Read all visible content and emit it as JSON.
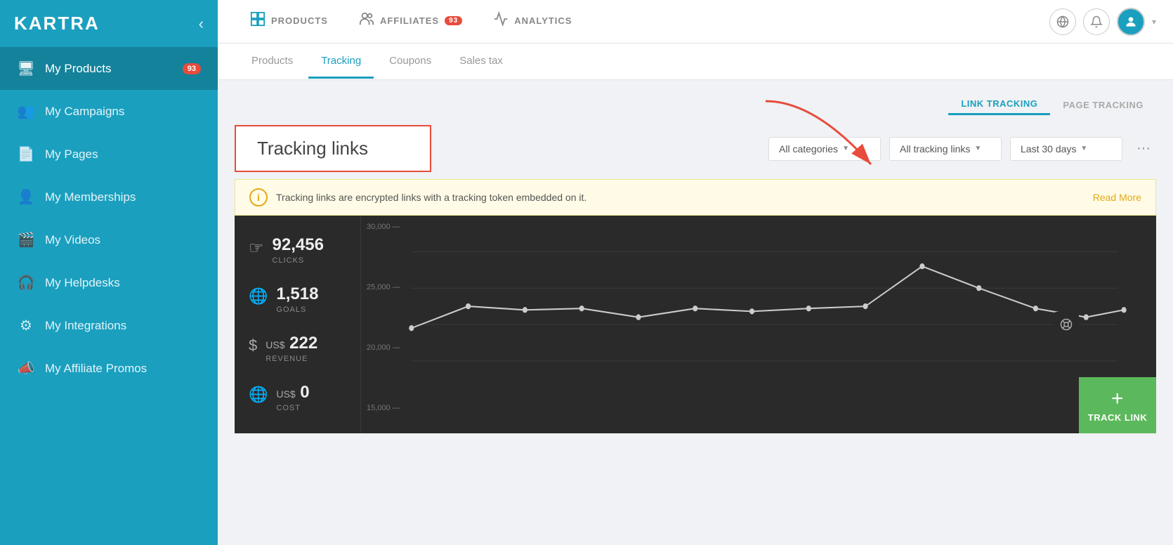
{
  "brand": {
    "name": "KARTRA"
  },
  "sidebar": {
    "collapse_label": "‹",
    "items": [
      {
        "id": "my-products",
        "label": "My Products",
        "icon": "🖥",
        "active": true,
        "badge": "93"
      },
      {
        "id": "my-campaigns",
        "label": "My Campaigns",
        "icon": "👥",
        "active": false,
        "badge": null
      },
      {
        "id": "my-pages",
        "label": "My Pages",
        "icon": "📄",
        "active": false,
        "badge": null
      },
      {
        "id": "my-memberships",
        "label": "My Memberships",
        "icon": "👤",
        "active": false,
        "badge": null
      },
      {
        "id": "my-videos",
        "label": "My Videos",
        "icon": "🎬",
        "active": false,
        "badge": null
      },
      {
        "id": "my-helpdesks",
        "label": "My Helpdesks",
        "icon": "🎧",
        "active": false,
        "badge": null
      },
      {
        "id": "my-integrations",
        "label": "My Integrations",
        "icon": "⚙",
        "active": false,
        "badge": null
      },
      {
        "id": "my-affiliate-promos",
        "label": "My Affiliate Promos",
        "icon": "📣",
        "active": false,
        "badge": null
      }
    ]
  },
  "topnav": {
    "items": [
      {
        "id": "products",
        "label": "PRODUCTS",
        "icon": "📦",
        "badge": null
      },
      {
        "id": "affiliates",
        "label": "AFFILIATES",
        "icon": "👥",
        "badge": "93"
      },
      {
        "id": "analytics",
        "label": "ANALYTICS",
        "icon": "📊",
        "badge": null
      }
    ],
    "right_icons": [
      {
        "id": "globe",
        "icon": "🌐"
      },
      {
        "id": "bell",
        "icon": "🔔"
      }
    ]
  },
  "subtabs": {
    "items": [
      {
        "id": "products",
        "label": "Products",
        "active": false
      },
      {
        "id": "tracking",
        "label": "Tracking",
        "active": true
      },
      {
        "id": "coupons",
        "label": "Coupons",
        "active": false
      },
      {
        "id": "sales-tax",
        "label": "Sales tax",
        "active": false
      }
    ]
  },
  "tracking_toggle": {
    "link_tracking": "LINK TRACKING",
    "page_tracking": "PAGE TRACKING",
    "active": "link_tracking"
  },
  "tracking_section": {
    "title": "Tracking links",
    "filters": {
      "categories": "All categories",
      "links": "All tracking links",
      "period": "Last 30 days"
    },
    "info_banner": {
      "message": "Tracking links are encrypted links with a tracking token embedded on it.",
      "read_more": "Read More"
    }
  },
  "chart": {
    "stats": [
      {
        "id": "clicks",
        "icon": "👆",
        "value": "92,456",
        "label": "CLICKS",
        "currency": ""
      },
      {
        "id": "goals",
        "icon": "🌐",
        "value": "1,518",
        "label": "GOALS",
        "currency": ""
      },
      {
        "id": "revenue",
        "icon": "$",
        "value": "222",
        "label": "REVENUE",
        "currency": "US$"
      },
      {
        "id": "cost",
        "icon": "🌐",
        "value": "0",
        "label": "COST",
        "currency": "US$"
      }
    ],
    "y_labels": [
      "30,000",
      "25,000",
      "20,000",
      "15,000"
    ],
    "line_points": "120,80 200,120 280,110 360,115 440,130 520,115 600,118 680,112 760,115 840,50 920,80 1000,115 1080,130 1160,120 1240,125 1320,95 1400,110"
  },
  "fab": {
    "plus": "+",
    "label": "TRACK LINK"
  }
}
